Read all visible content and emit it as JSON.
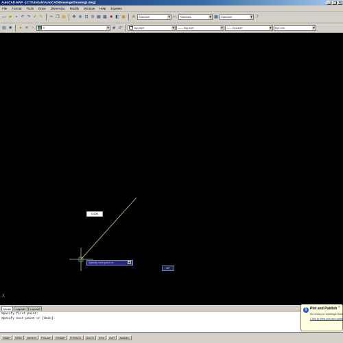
{
  "window": {
    "title": "AutoCAD MAP - [C:\\Tutorials\\AutoCAD\\Drawings\\Drawing1.dwg]",
    "btn_min": "_",
    "btn_max": "□",
    "btn_close": "×"
  },
  "menu": [
    "File",
    "Format",
    "Tools",
    "Draw",
    "Dimension",
    "Modify",
    "Window",
    "Help",
    "Express"
  ],
  "toolbar": {
    "layer_value": "0",
    "textstyle_value": "Standard",
    "dimstyle_value": "Standard",
    "color_value": "ByLayer",
    "linetype_value": "ByLayer",
    "lineweight_value": "ByLayer",
    "plotstyle_value": "ByColor",
    "layer_color": "#2fbf2f"
  },
  "canvas": {
    "dynamic_length": "0.000",
    "dynamic_prompt": "Specify next point or",
    "dynamic_angle": "45°",
    "ucs_label": "X"
  },
  "tabs": [
    "Model",
    "Layout1",
    "Layout2"
  ],
  "command": {
    "line1": "",
    "line2": "Specify first point:",
    "line3": "Specify next point or [Undo]:"
  },
  "status": [
    "SNAP",
    "GRID",
    "ORTHO",
    "POLAR",
    "OSNAP",
    "OTRACK",
    "DUCS",
    "DYN",
    "LWT",
    "MODEL"
  ],
  "balloon": {
    "title": "Plot and Publish",
    "text": "No errors or warnings found",
    "link": "Click to view plot and publish",
    "close": "×"
  }
}
